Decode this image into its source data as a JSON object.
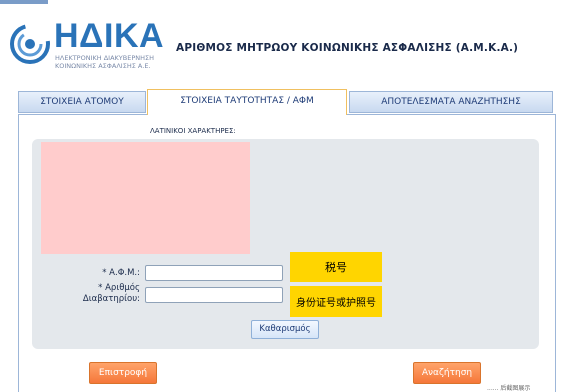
{
  "header": {
    "logo_main": "ΗΔΙΚΑ",
    "logo_sub_line1": "ΗΛΕΚΤΡΟΝΙΚΗ ΔΙΑΚΥΒΕΡΝΗΣΗ",
    "logo_sub_line2": "ΚΟΙΝΩΝΙΚΗΣ ΑΣΦΑΛΙΣΗΣ Α.Ε.",
    "title": "ΑΡΙΘΜΟΣ ΜΗΤΡΩΟΥ ΚΟΙΝΩΝΙΚΗΣ ΑΣΦΑΛΙΣΗΣ (Α.Μ.Κ.Α.)"
  },
  "tabs": [
    {
      "label": "ΣΤΟΙΧΕΙΑ ΑΤΟΜΟΥ",
      "active": false
    },
    {
      "label": "ΣΤΟΙΧΕΙΑ ΤΑΥΤΟΤΗΤΑΣ / ΑΦΜ",
      "active": true
    },
    {
      "label": "ΑΠΟΤΕΛΕΣΜΑΤΑ ΑΝΑΖΗΤΗΣΗΣ",
      "active": false
    }
  ],
  "form": {
    "latin_label": "ΛΑΤΙΝΙΚΟΙ ΧΑΡΑΚΤΗΡΕΣ:",
    "afm_label": "* Α.Φ.Μ.:",
    "afm_value": "",
    "passport_label_line1": "* Αριθμός",
    "passport_label_line2": "Διαβατηρίου:",
    "passport_value": "",
    "note_afm": "税号",
    "note_passport": "身份证号或护照号",
    "clear_button": "Καθαρισμός"
  },
  "actions": {
    "back_button": "Επιστροφή",
    "search_button": "Αναζήτηση"
  },
  "watermark": "...... 后截图展示",
  "colors": {
    "accent_blue": "#2a73b8",
    "tab_active_border": "#f0c060",
    "orange_button": "#f5773a",
    "note_yellow": "#ffd500",
    "redacted_area": "#ffcccc"
  }
}
